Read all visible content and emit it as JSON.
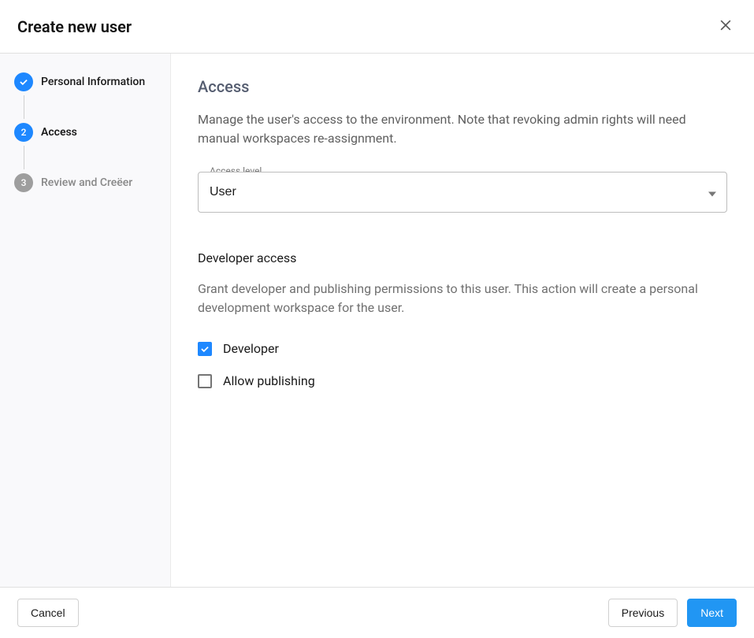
{
  "header": {
    "title": "Create new user"
  },
  "sidebar": {
    "steps": [
      {
        "label": "Personal Information",
        "state": "done",
        "num": ""
      },
      {
        "label": "Access",
        "state": "active",
        "num": "2"
      },
      {
        "label": "Review and Creëer",
        "state": "pending",
        "num": "3"
      }
    ]
  },
  "main": {
    "access": {
      "title": "Access",
      "desc": "Manage the user's access to the environment. Note that revoking admin rights will need manual workspaces re-assignment.",
      "level_label": "Access level",
      "level_value": "User"
    },
    "developer": {
      "title": "Developer access",
      "desc": "Grant developer and publishing permissions to this user. This action will create a personal development workspace for the user.",
      "checkbox_developer": "Developer",
      "checkbox_publishing": "Allow publishing"
    }
  },
  "footer": {
    "cancel": "Cancel",
    "previous": "Previous",
    "next": "Next"
  }
}
